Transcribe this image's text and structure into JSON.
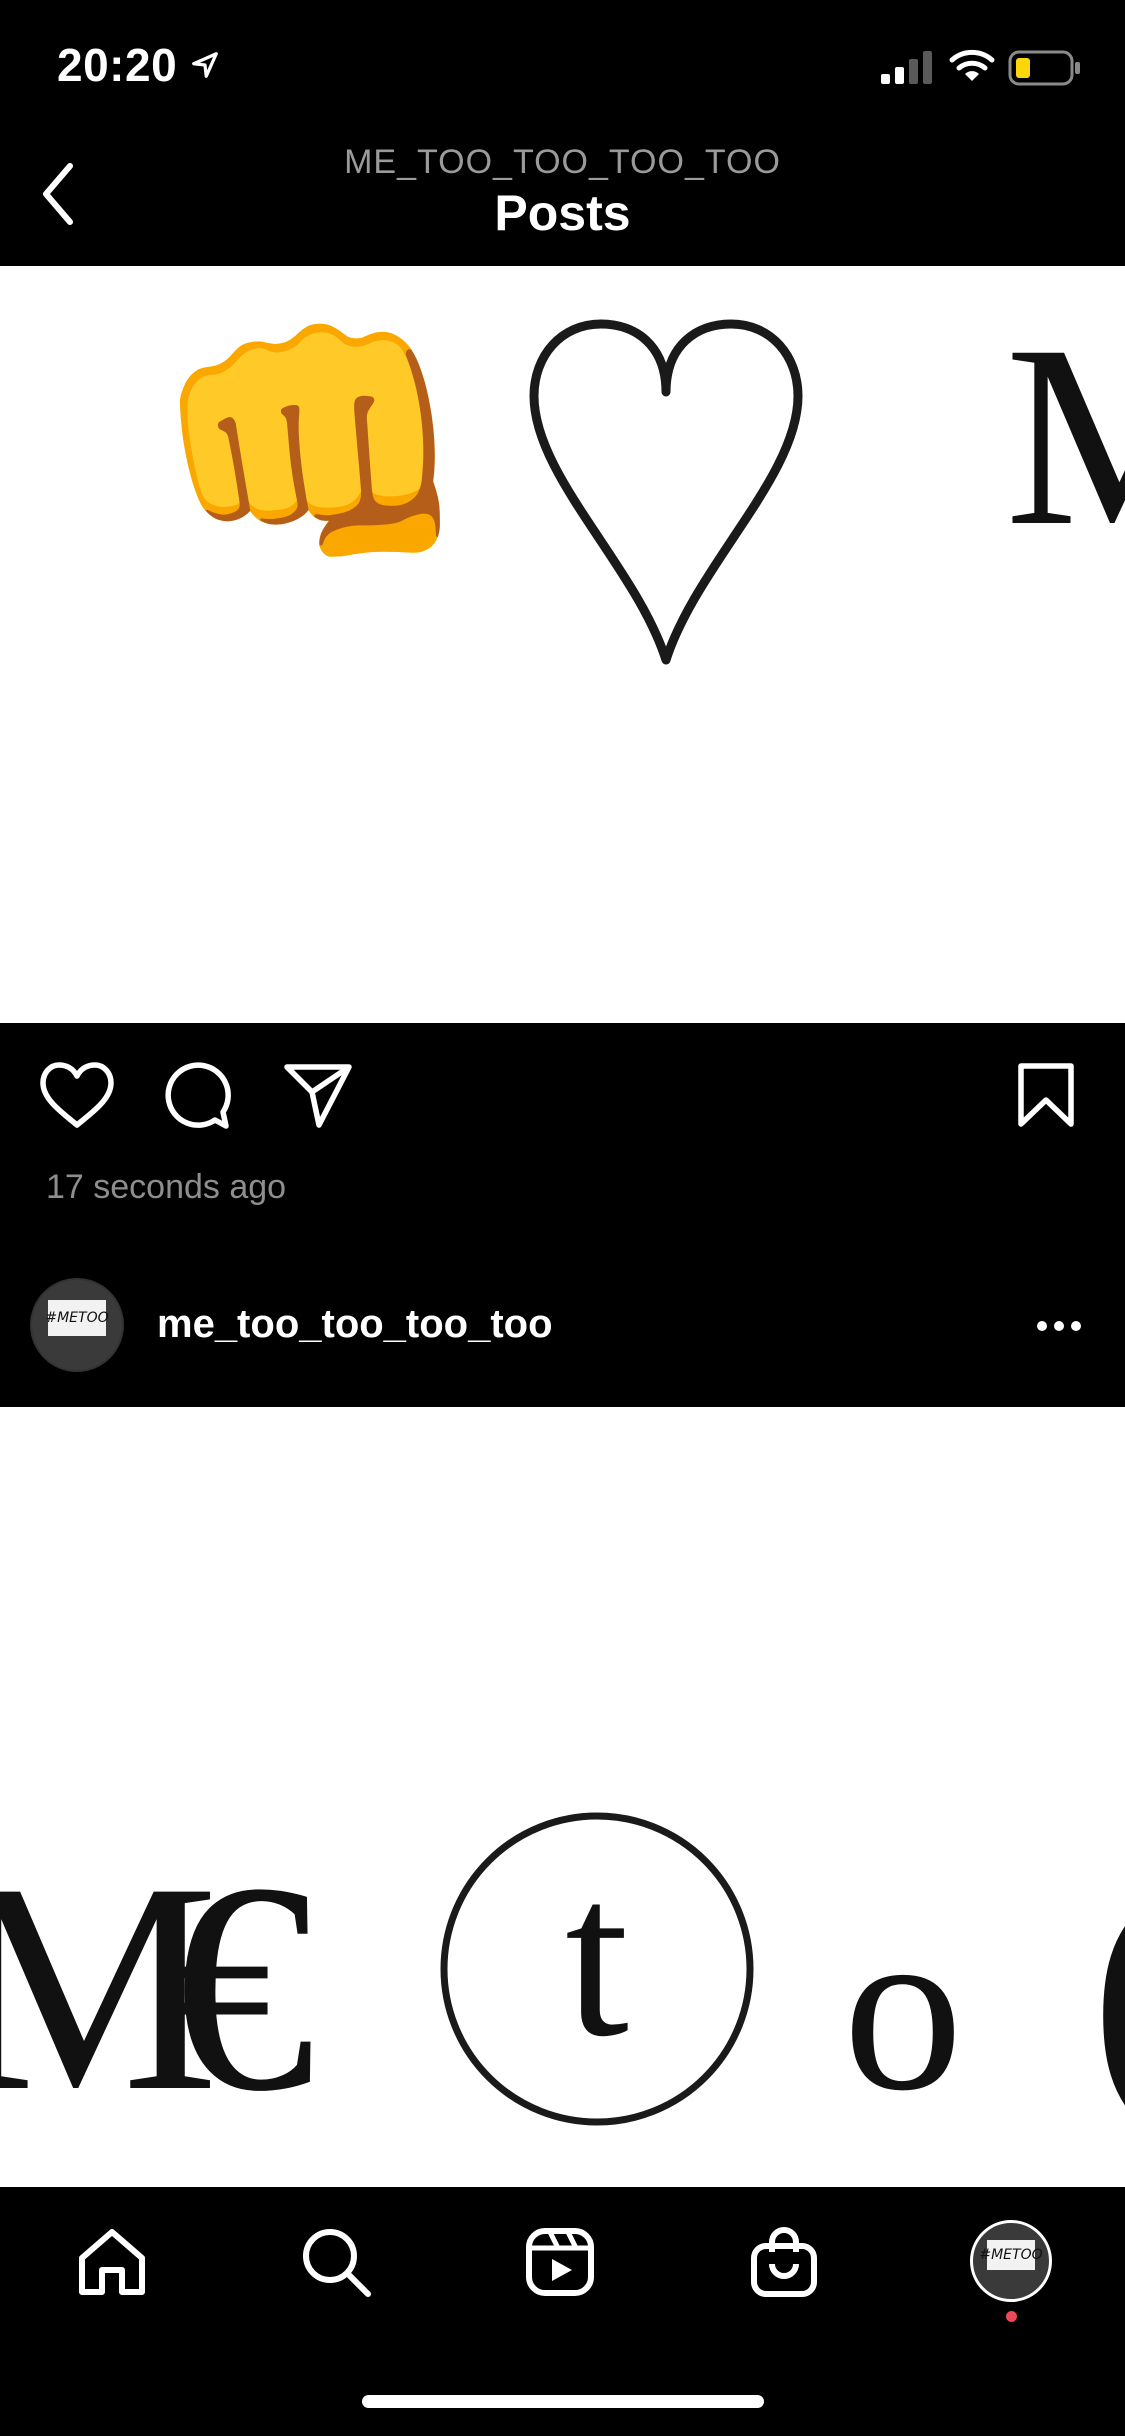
{
  "status_bar": {
    "time": "20:20"
  },
  "header": {
    "username": "ME_TOO_TOO_TOO_TOO",
    "title": "Posts"
  },
  "post1": {
    "image_glyphs": {
      "fist": "👊",
      "right_letter": "M"
    },
    "timestamp": "17 seconds ago"
  },
  "post2": {
    "username": "me_too_too_too_too",
    "avatar_sign_text": "#METOO",
    "image_glyphs": {
      "m": "M",
      "euro": "€",
      "t": "t",
      "o": "o",
      "partial": "("
    }
  },
  "tabbar": {
    "items": [
      "home-icon",
      "search-icon",
      "reels-icon",
      "shop-icon",
      "profile-avatar"
    ]
  },
  "colors": {
    "background": "#000000",
    "secondary_text": "#8e8e8e",
    "notification": "#ed4956",
    "battery_fill": "#ffd60a"
  }
}
